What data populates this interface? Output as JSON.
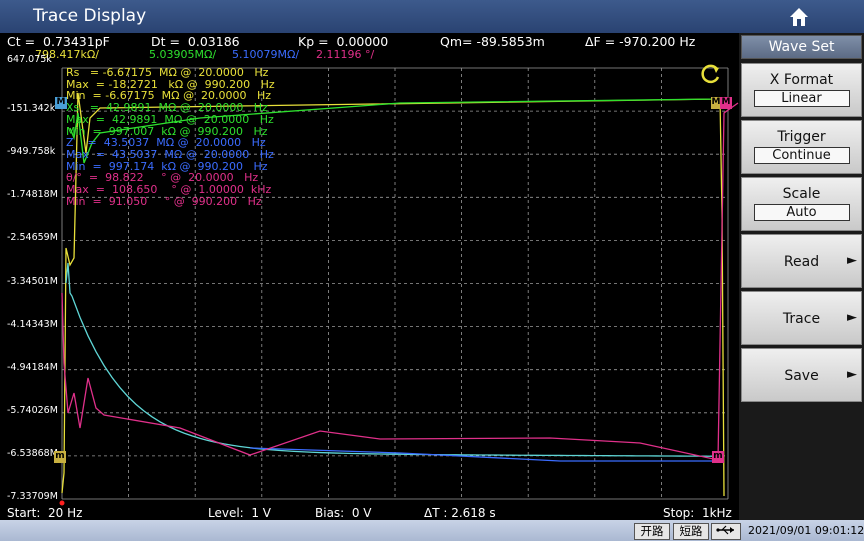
{
  "window": {
    "title": "Trace Display",
    "home_icon": "home-icon"
  },
  "header": {
    "ct": "Ct =  0.73431pF",
    "dt": "Dt =  0.03186",
    "kp": "Kp =  0.00000",
    "qm": "Qm= -89.5853m",
    "df": "ΔF = -970.200 Hz",
    "sub": [
      {
        "text": "798.417kΩ/",
        "color": "#e8e03a"
      },
      {
        "text": "5.03905MΩ/",
        "color": "#2ee02e"
      },
      {
        "text": "5.10079MΩ/",
        "color": "#3b6cff"
      },
      {
        "text": "2.11196 °/",
        "color": "#e0308a"
      }
    ]
  },
  "y_axis": {
    "labels": [
      "647.075k",
      "-151.342k",
      "-949.758k",
      "-1.74818M",
      "-2.54659M",
      "-3.34501M",
      "-4.14343M",
      "-4.94184M",
      "-5.74026M",
      "-6.53868M",
      "-7.33709M"
    ]
  },
  "markers": {
    "left": "M",
    "right": "M",
    "low_left": "m",
    "low_right": "m"
  },
  "stats": [
    {
      "text": "Rs   = -6.67175  MΩ @  20.0000   Hz",
      "color": "#e8e03a"
    },
    {
      "text": "Max  = -18.2721   kΩ @  990.200   Hz",
      "color": "#e8e03a"
    },
    {
      "text": "Min  = -6.67175  MΩ @  20.0000   Hz",
      "color": "#e8e03a"
    },
    {
      "text": "Xs   =  42.9891  MΩ @  20.0000   Hz",
      "color": "#2ee02e"
    },
    {
      "text": "Max  =  42.9891  MΩ @  20.0000   Hz",
      "color": "#2ee02e"
    },
    {
      "text": "Min  =  997.007  kΩ @  990.200   Hz",
      "color": "#2ee02e"
    },
    {
      "text": "Z    =  43.5037  MΩ @  20.0000   Hz",
      "color": "#3b6cff"
    },
    {
      "text": "Max  =  43.5037  MΩ @  20.0000   Hz",
      "color": "#3b6cff"
    },
    {
      "text": "Min  =  997.174  kΩ @  990.200   Hz",
      "color": "#3b6cff"
    },
    {
      "text": "θ/°  =  98.822     ° @  20.0000   Hz",
      "color": "#e0308a"
    },
    {
      "text": "Max  =  108.650    ° @  1.00000  kHz",
      "color": "#e0308a"
    },
    {
      "text": "Min  =  91.050     ° @  990.200   Hz",
      "color": "#e0308a"
    }
  ],
  "footer": {
    "start": "Start:  20 Hz",
    "level": "Level:  1 V",
    "bias": "Bias:  0 V",
    "dt": "ΔT : 2.618 s",
    "stop": "Stop:  1kHz"
  },
  "sidebar": {
    "header": "Wave Set",
    "xformat": {
      "label": "X Format",
      "value": "Linear"
    },
    "trigger": {
      "label": "Trigger",
      "value": "Continue"
    },
    "scale": {
      "label": "Scale",
      "value": "Auto"
    },
    "read": "Read",
    "trace": "Trace",
    "save": "Save",
    "arrow": "►"
  },
  "status": {
    "open": "开路",
    "short": "短路",
    "usb_icon": "usb-icon",
    "time": "2021/09/01 09:01:12"
  },
  "colors": {
    "yellow": "#e8e03a",
    "green": "#2ee02e",
    "blue": "#3b6cff",
    "magenta": "#e0308a",
    "cyan": "#5fd6d6"
  }
}
